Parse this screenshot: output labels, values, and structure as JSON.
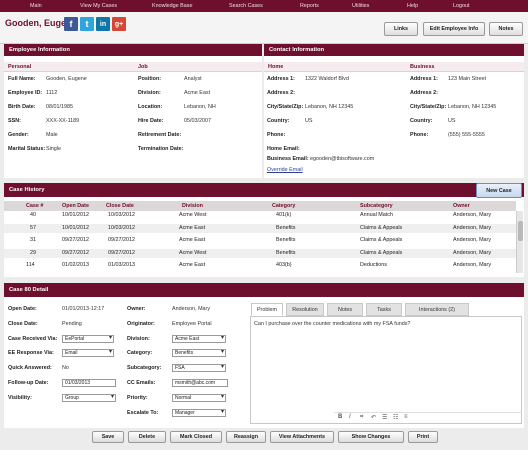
{
  "nav": [
    "Main",
    "View My Cases",
    "Knowledge Base",
    "Search Cases",
    "Reports",
    "Utilities",
    "Help",
    "Logout"
  ],
  "employee_name": "Gooden, Eugene",
  "social": [
    {
      "letter": "f",
      "color": "#3b5998",
      "icon": "facebook-icon"
    },
    {
      "letter": "t",
      "color": "#2fa5dd",
      "icon": "twitter-icon"
    },
    {
      "letter": "in",
      "color": "#0e76a8",
      "icon": "linkedin-icon"
    },
    {
      "letter": "g+",
      "color": "#d34836",
      "icon": "google-plus-icon"
    }
  ],
  "top_buttons": {
    "links": "Links",
    "edit": "Edit Employee Info",
    "notes": "Notes"
  },
  "emp_info": {
    "title": "Employee Information",
    "personal": "Personal",
    "job": "Job",
    "personal_fields": [
      [
        "Full Name:",
        "Gooden, Eugene"
      ],
      [
        "Employee ID:",
        "1112"
      ],
      [
        "Birth Date:",
        "08/01/1985"
      ],
      [
        "SSN:",
        "XXX-XX-1189"
      ],
      [
        "Gender:",
        "Male"
      ],
      [
        "Marital Status:",
        "Single"
      ]
    ],
    "job_fields": [
      [
        "Position:",
        "Analyst"
      ],
      [
        "Division:",
        "Acme East"
      ],
      [
        "Location:",
        "Lebanon, NH"
      ],
      [
        "Hire Date:",
        "05/03/2007"
      ],
      [
        "Retirement Date:",
        ""
      ],
      [
        "Termination Date:",
        ""
      ]
    ]
  },
  "contact": {
    "title": "Contact Information",
    "home": "Home",
    "business": "Business",
    "home_fields": [
      [
        "Address 1:",
        "1322 Waldorf Blvd"
      ],
      [
        "Address 2:",
        ""
      ],
      [
        "City/State/Zip:",
        "Lebanon, NH 12345"
      ],
      [
        "Country:",
        "US"
      ],
      [
        "Phone:",
        ""
      ],
      [
        "Home Email:",
        ""
      ],
      [
        "Business Email:",
        "egooden@tbisoftware.com"
      ]
    ],
    "business_fields": [
      [
        "Address 1:",
        "123 Main Street"
      ],
      [
        "Address 2:",
        ""
      ],
      [
        "City/State/Zip:",
        "Lebanon, NH 12345"
      ],
      [
        "Country:",
        "US"
      ],
      [
        "Phone:",
        "(555) 555-5555"
      ]
    ],
    "override": "Override Email"
  },
  "case_history": {
    "title": "Case History",
    "new_case": "New Case",
    "columns": [
      "Case #",
      "Open Date",
      "Close Date",
      "Division",
      "Category",
      "Subcategory",
      "Owner"
    ],
    "rows": [
      [
        "40",
        "10/01/2012",
        "10/03/2012",
        "Acme West",
        "401(k)",
        "Annual Match",
        "Anderson, Mary"
      ],
      [
        "57",
        "10/01/2012",
        "10/03/2012",
        "Acme East",
        "Benefits",
        "Claims & Appeals",
        "Anderson, Mary"
      ],
      [
        "31",
        "09/27/2012",
        "09/27/2012",
        "Acme East",
        "Benefits",
        "Claims & Appeals",
        "Anderson, Mary"
      ],
      [
        "29",
        "09/27/2012",
        "09/27/2012",
        "Acme West",
        "Benefits",
        "Claims & Appeals",
        "Anderson, Mary"
      ],
      [
        "114",
        "01/02/2013",
        "01/03/2013",
        "Acme East",
        "403(b)",
        "Deductions",
        "Anderson, Mary"
      ]
    ]
  },
  "detail": {
    "title": "Case 80 Detail",
    "open_date": [
      "Open Date:",
      "01/01/2013-12:17"
    ],
    "close_date": [
      "Close Date:",
      "Pending"
    ],
    "received": [
      "Case Received Via:",
      "EePortal"
    ],
    "response": [
      "EE Response Via:",
      "Email"
    ],
    "quick": [
      "Quick Answered:",
      "No"
    ],
    "followup": [
      "Follow-up Date:",
      "01/03/2013"
    ],
    "visibility": [
      "Visibility:",
      "Group"
    ],
    "owner": [
      "Owner:",
      "Anderson, Mary"
    ],
    "originator": [
      "Originator:",
      "Employee Portal"
    ],
    "division": [
      "Division:",
      "Acme East"
    ],
    "category": [
      "Category:",
      "Benefits"
    ],
    "subcategory": [
      "Subcategory:",
      "FSA"
    ],
    "cc": [
      "CC Emails:",
      "msmith@abc.com"
    ],
    "priority": [
      "Priority:",
      "Normal"
    ],
    "escalate": [
      "Escalate To:",
      "Manager"
    ],
    "tabs": [
      "Problem",
      "Resolution",
      "Notes",
      "Tasks",
      "Interactions (2)"
    ],
    "problem_text": "Can I purchase over the counter medications with my FSA funds?",
    "toolbar": [
      "B",
      "I",
      "⌗",
      "↶",
      "☰",
      "☷",
      "≡"
    ]
  },
  "buttons": [
    "Save",
    "Delete",
    "Mark Closed",
    "Reassign",
    "View Attachments",
    "Show Changes",
    "Print"
  ]
}
